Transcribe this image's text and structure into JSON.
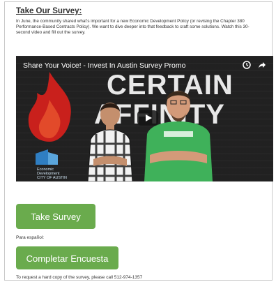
{
  "title": "Take Our Survey:",
  "intro": "In June, the community shared what's important for a new Economic Development Policy (or revising the Chapter 380 Performance-Based Contracts Policy). We want to dive deeper into that feedback to craft some solutions. Watch this 30-second video and fill out the survey.",
  "video": {
    "title": "Share Your Voice! - Invest In Austin Survey Promo",
    "brand_line1": "CERTAIN",
    "brand_line2": "AFFINITY",
    "logo_text_line1": "Economic",
    "logo_text_line2": "Development",
    "logo_text_line3": "CITY OF AUSTIN",
    "clock_icon": "clock-icon",
    "share_icon": "share-icon"
  },
  "buttons": {
    "take_survey": "Take Survey",
    "para_espanol": "Para español:",
    "completar": "Completar Encuesta"
  },
  "footer": "To request a hard copy of the survey, please call 512-974-1357",
  "colors": {
    "button_green": "#6aab4d",
    "flame_red": "#c9201c",
    "shirt_green": "#3fb15a"
  }
}
